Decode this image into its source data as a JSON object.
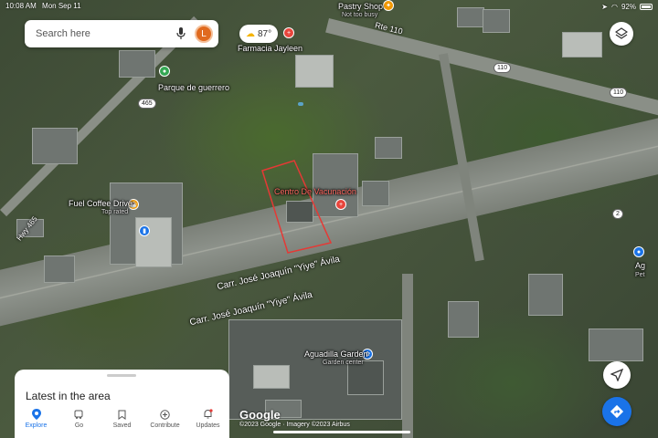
{
  "status_bar": {
    "time": "10:08 AM",
    "date": "Mon Sep 11",
    "battery": "92%"
  },
  "search": {
    "placeholder": "Search here",
    "avatar_initial": "L"
  },
  "weather": {
    "temperature": "87°"
  },
  "map": {
    "places": [
      {
        "name": "Pastry Shop",
        "sub": "Not too busy"
      },
      {
        "name": "Farmacia Jayleen"
      },
      {
        "name": "Parque de guerrero"
      },
      {
        "name": "Centro De Vacunación"
      },
      {
        "name": "Fuel Coffee Drive",
        "sub": "Top rated"
      },
      {
        "name": "Aguadilla Garden",
        "sub": "Garden center"
      },
      {
        "name": "Ag",
        "sub": "Pet"
      }
    ],
    "roads": [
      {
        "name": "Rte 110"
      },
      {
        "name": "Hwy 465"
      },
      {
        "name": "Carr. José Joaquín \"Yiye\" Ávila"
      },
      {
        "name": "Carr. José Joaquín \"Yiye\" Ávila"
      }
    ],
    "shields": [
      "110",
      "110",
      "465",
      "2"
    ],
    "attribution": {
      "logo": "Google",
      "copyright": "©2023 Google · Imagery ©2023 Airbus"
    }
  },
  "sheet": {
    "title": "Latest in the area",
    "tabs": [
      {
        "label": "Explore",
        "icon": "map-pin-icon",
        "active": true
      },
      {
        "label": "Go",
        "icon": "commute-icon",
        "active": false
      },
      {
        "label": "Saved",
        "icon": "bookmark-icon",
        "active": false
      },
      {
        "label": "Contribute",
        "icon": "plus-circle-icon",
        "active": false
      },
      {
        "label": "Updates",
        "icon": "bell-icon",
        "active": false
      }
    ]
  },
  "colors": {
    "accent": "#1a73e8",
    "outline": "#e53935",
    "avatar": "#e06a1f"
  }
}
